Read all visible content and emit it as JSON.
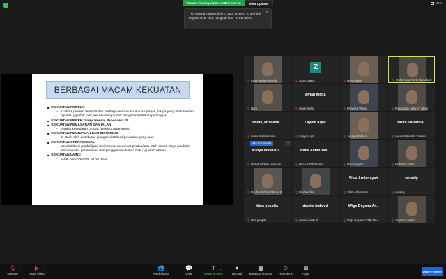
{
  "top": {
    "viewing_text": "You are viewing vivian metta's screen",
    "view_options": "View Options",
    "view_label": "View"
  },
  "tooltip": {
    "text": "The shared content is fit to your screen. To see the original size, click \"Original size\" in the menu."
  },
  "slide": {
    "title": "BERBAGAI MACAM KEKUATAN",
    "sections": [
      {
        "head": "KEKUATAN PRODUK",
        "sub": [
          "Kualitas produk, tersedia dlm berbagai warna/ukuran dan pilihan, harga yang lebih rendah, reputasi yg lebih baik, kesesuaian produk dengan kebutuhan pelanggan"
        ]
      },
      {
        "head": "KEKUATAN MEREK: Sony, Honda, Pepsodent dll",
        "sub": []
      },
      {
        "head": "KEKUATAN PEMASARAN DAN IKLAN",
        "sub": [
          "Tingkat kesadaran produk (product awareness),"
        ]
      },
      {
        "head": "KEKUATAN PENJUALAN DAN DISTRIBUSI",
        "sub": [
          "Di stock oleh distributor, jaringan distribusi/penjualan yang luas."
        ]
      },
      {
        "head": "KEKUATAN OPERASIONAL",
        "sub": [
          "Mendistribusi produk/jasa lebih cepat, membuat produk/jasa lebih cepat, biaya produksi lebih rendah, penerimaan dan penggunaan bahan baku yg lebih efisien."
        ]
      },
      {
        "head": "KEKUATAN LAIN2:",
        "sub": [
          "SDM, KEUANGAN, STRATEGI"
        ]
      }
    ]
  },
  "gallery": {
    "ask_to_unmute": "Ask to Unmute",
    "ask_more": "...",
    "tiles": [
      {
        "name": "Erisa Nopia Fitrianda",
        "big": "",
        "video": true
      },
      {
        "name": "zoom baa04",
        "big": "",
        "video": false,
        "avatar": "Z"
      },
      {
        "name": "devy Riana",
        "big": "",
        "video": true
      },
      {
        "name": "Mohammad Rizki Ramdhani",
        "big": "",
        "video": true,
        "active": true
      },
      {
        "name": "Narti",
        "big": "",
        "video": true
      },
      {
        "name": "vivian metta",
        "big": "vivian metta",
        "video": false
      },
      {
        "name": "Princesa Wijaya",
        "big": "",
        "video": true
      },
      {
        "name": "Rosadinda Defany Cahya",
        "big": "",
        "video": true
      },
      {
        "name": "revita afrilliana rosa",
        "big": "revita_afrilliana...",
        "video": false
      },
      {
        "name": "Layyin Aqila",
        "big": "Layyin Aqila",
        "video": false
      },
      {
        "name": "Jesslyn Patricia",
        "big": "",
        "video": true
      },
      {
        "name": "Haura Salsabila Zahrana",
        "big": "Haura Salsabila...",
        "video": false
      },
      {
        "name": "Nistya Widelia Vanessa",
        "big": "Nistya Widelia V...",
        "video": false
      },
      {
        "name": "Hana Alifah Yasmin",
        "big": "Hana Alifah Yas...",
        "video": false
      },
      {
        "name": "Dina Angelica",
        "big": "",
        "video": true
      },
      {
        "name": "Mohrifah Safitri",
        "big": "",
        "video": true
      },
      {
        "name": "Naufal Fachrurrahman R",
        "big": "",
        "video": true
      },
      {
        "name": "Dinda Arlita",
        "big": "",
        "video": true
      },
      {
        "name": "Silva Ardiansyah",
        "big": "Silva Ardiansyah",
        "video": false
      },
      {
        "name": "renaldy",
        "big": "renaldy",
        "video": false
      },
      {
        "name": "tiara puspita",
        "big": "tiara puspita",
        "video": false
      },
      {
        "name": "devina indah d",
        "big": "devina indah d",
        "video": false
      },
      {
        "name": "Wigo Deyana Artilia Ma...",
        "big": "Wigo Deyana Ar...",
        "video": false
      },
      {
        "name": "Yohanes Adrian",
        "big": "",
        "video": true
      }
    ]
  },
  "toolbar": {
    "unmute": "Unmute",
    "start_video": "Start Video",
    "participants": "Participants",
    "participants_count": "24",
    "chat": "Chat",
    "share_screen": "Share Screen",
    "record": "Record",
    "breakout_rooms": "Breakout Rooms",
    "reactions": "Reactions",
    "apps": "Apps",
    "leave_room": "Leave Room"
  },
  "colors": {
    "accent_green": "#24a148",
    "leave_blue": "#1f66d4",
    "active_speaker": "#cfe35e",
    "mic_off_red": "#e03b3b"
  }
}
